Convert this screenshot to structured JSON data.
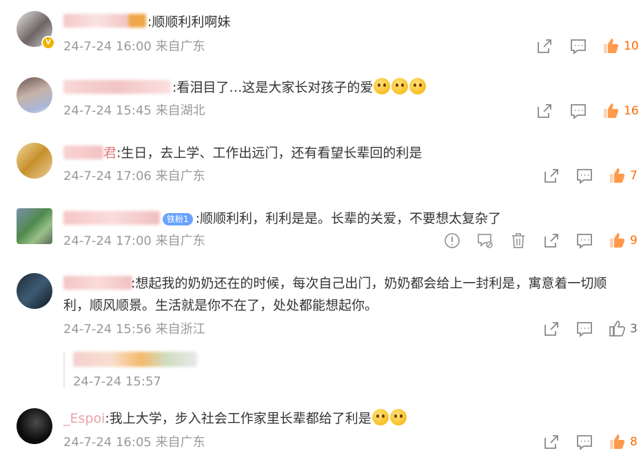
{
  "comments": [
    {
      "text": ":顺顺利利啊妹",
      "date": "24-7-24 16:00",
      "location": "来自广东",
      "likes": "10"
    },
    {
      "text": ":看泪目了…这是大家长对孩子的爱",
      "date": "24-7-24 15:45",
      "location": "来自湖北",
      "likes": "16"
    },
    {
      "name_tail": "君",
      "text": ":生日，去上学、工作出远门，还有看望长辈回的利是",
      "date": "24-7-24 17:06",
      "location": "来自广东",
      "likes": "7"
    },
    {
      "fan_badge": "铁粉1",
      "text": ":顺顺利利，利利是是。长辈的关爱，不要想太复杂了",
      "date": "24-7-24 17:00",
      "location": "来自广东",
      "likes": "9"
    },
    {
      "text_line1": ":想起我的奶奶还在的时候，每次自己出门，奶奶都会给上一封利是，寓意着一切顺",
      "text_line2": "利，顺风顺景。生活就是你不在了，处处都能想起你。",
      "date": "24-7-24 15:56",
      "location": "来自浙江",
      "likes": "3"
    },
    {
      "date": "24-7-24 15:57"
    },
    {
      "name_tail": "_Espoi",
      "text": ":我上大学，步入社会工作家里长辈都给了利是",
      "date": "24-7-24 16:05",
      "location": "来自广东",
      "likes": "8"
    }
  ],
  "icons": {
    "share": "share-icon",
    "comment": "comment-icon",
    "like": "thumbs-up-icon",
    "report": "report-icon",
    "block": "block-icon",
    "delete": "trash-icon"
  },
  "colors": {
    "accent": "#ff6b00",
    "meta": "#999999",
    "text": "#333333"
  }
}
